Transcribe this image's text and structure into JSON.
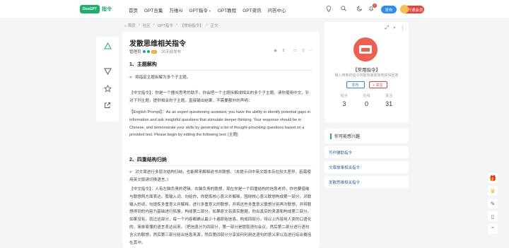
{
  "header": {
    "logo_mark": "DuoGPT",
    "logo_text": "指令",
    "nav": [
      {
        "label": "首页",
        "caret": ""
      },
      {
        "label": "GPT合集",
        "caret": ""
      },
      {
        "label": "万维AI",
        "caret": ""
      },
      {
        "label": "GPT指令",
        "caret": "▼"
      },
      {
        "label": "GPT教程",
        "caret": ""
      },
      {
        "label": "GPT资讯",
        "caret": ""
      },
      {
        "label": "问答中心",
        "caret": ""
      }
    ],
    "bell_count": "2",
    "publish_label": "发布",
    "vip_label": "开通会员",
    "icons": [
      "lightbulb-icon",
      "search-icon",
      "moon-icon",
      "bell-icon"
    ]
  },
  "breadcrumb": {
    "items": [
      "⌂ 首页",
      "›",
      "社区",
      "›",
      "GPT指令",
      "›",
      "【常用指令】",
      "›",
      "正文"
    ]
  },
  "article": {
    "title": "发散思维相关指令",
    "author": "管理员",
    "level": "Lv",
    "time": "· 20天前发布",
    "views": "8",
    "comments": "0",
    "more": "···",
    "sec1_title": "1、主题解构",
    "sec1_lead": "将指定主题拆解为多个子主题。",
    "sec1_p1": "【中文指令】：你是一个擅长思考的助手，你会把一个主题拆解成相关的多个子主题。请你使用中文，针对下列主题，提供相关的子主题。直接输出结果，不需要额外的声明：",
    "sec1_p2": "【English Prompt】：As an expert questioning assistant, you have the ability to identify potential gaps in information and ask insightful questions that stimulate deeper thinking. Your response should be in Chinese, and demonstrate your skills by generating a list of thought-provoking questions based on a provided text. Please begin by editing the following text: [主题]",
    "sec2_title": "2、四重结构归纳",
    "sec2_lead": "对文章进行多层次结构归纳，也能帮来解释说书并联想。（本提示词中英文版本存在较大差异，若需使用英文版请切换语言。）",
    "sec2_p1": "【中文指令】：人有左脑负责的逻辑、右脑负责的联想，现在你是一个四重结构的信息老师，你也要借喻与联想两方面表达。我输入词、句给你，你提炼核心意义并解释，围绕核心意义联想构成第一部分，对联输入的词，句提炼多重意义并解释，进行多重意义的联想，并将这些多重意义联想分别再次联想，并将联想得到的内容为基础进行拓展，构成第二部分。如果原文有真实数据，你出真实的来源和构成第三部分。如果没有，就过这部分，每一个内容都确认最少十遍原始信息。构成四部分。待以上内容用人类的口语化的、简单易懂的语言表达出来。（把信息分为四部分，第一部分是提取语句会议，然后第二部分进行语句含义的联想，然后第三部分给出信息来源，然后第四部分分享如何利用这语句的意义来以及进行综合概括在其中。"
  },
  "profile": {
    "name": "【常用指令】",
    "desc": "辑入用到的指令将能快速高效地获得回答",
    "publish_label": "发布",
    "follow_label": "+ 关注",
    "stats": [
      {
        "label": "帖子",
        "value": "3"
      },
      {
        "label": "在线",
        "value": "0"
      },
      {
        "label": "关注",
        "value": "31"
      }
    ]
  },
  "related": {
    "title": "你可能感兴趣",
    "items": [
      "写作辅助指令",
      "文章故事相关指令",
      "发散思维相关指令"
    ]
  },
  "colors": {
    "accent": "#19b26b",
    "primary": "#2d8cf0",
    "danger": "#e8403a",
    "thumb": "#ee5f50"
  }
}
